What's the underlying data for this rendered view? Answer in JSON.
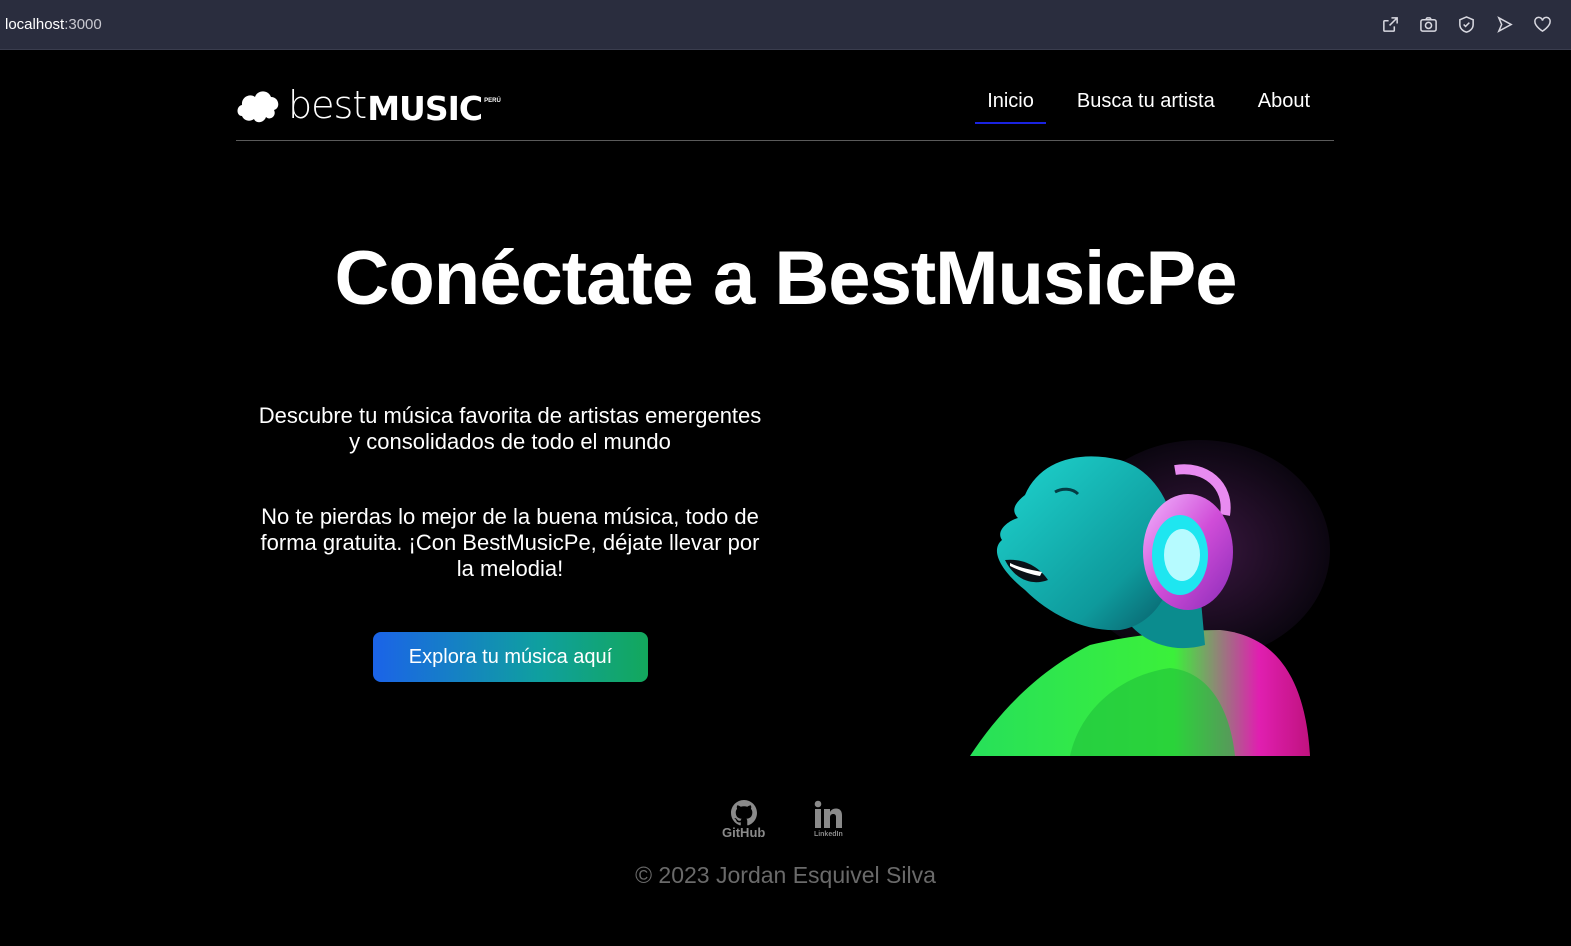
{
  "browser": {
    "url_host": "localhost",
    "url_port": ":3000",
    "icons": [
      "share-icon",
      "camera-icon",
      "shield-icon",
      "play-icon",
      "heart-icon"
    ]
  },
  "nav": {
    "logo": {
      "part1": "best",
      "part2": "MUSIC",
      "suffix": "PERÚ"
    },
    "links": [
      "Inicio",
      "Busca tu artista",
      "About"
    ],
    "active_index": 0,
    "active_color": "#1a23e0"
  },
  "hero": {
    "title": "Conéctate a BestMusicPe",
    "paragraph1": "Descubre tu música favorita de artistas emergentes y consolidados de todo el mundo",
    "paragraph2": "No te pierdas lo mejor de la buena música, todo de forma gratuita. ¡Con BestMusicPe, déjate llevar por la melodia!",
    "cta_label": "Explora tu música aquí"
  },
  "footer": {
    "github_label": "GitHub",
    "linkedin_label": "LinkedIn",
    "copyright": "© 2023 Jordan Esquivel Silva"
  },
  "colors": {
    "background": "#000000",
    "browser_bar": "#2a2d3e",
    "cta_gradient": [
      "#1b63e8",
      "#13a85c"
    ],
    "footer_text": "#6a6a6a"
  }
}
